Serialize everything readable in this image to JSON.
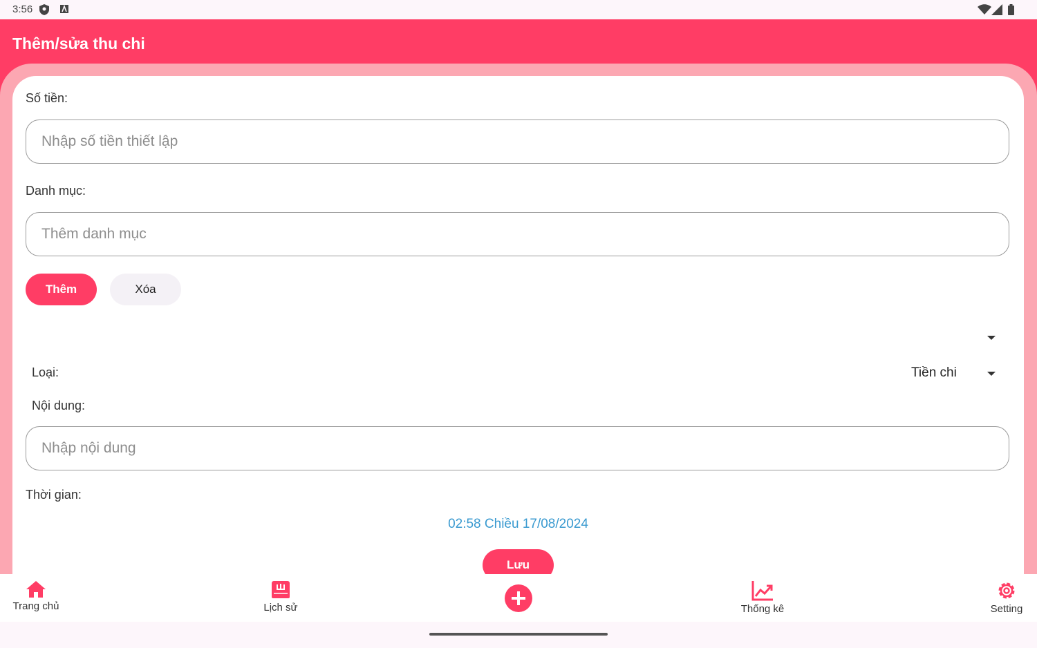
{
  "status_bar": {
    "time": "3:56"
  },
  "app_bar": {
    "title": "Thêm/sửa thu chi"
  },
  "form": {
    "amount_label": "Số tiền:",
    "amount_placeholder": "Nhập số tiền thiết lập",
    "category_label": "Danh mục:",
    "category_placeholder": "Thêm danh mục",
    "add_button": "Thêm",
    "delete_button": "Xóa",
    "category_dropdown_value": "",
    "type_label": "Loại:",
    "type_value": "Tiền chi",
    "content_label": "Nội dung:",
    "content_placeholder": "Nhập nội dung",
    "time_label": "Thời gian:",
    "datetime_value": "02:58 Chiều 17/08/2024",
    "save_button": "Lưu"
  },
  "bottom_nav": {
    "items": [
      {
        "label": "Trang chủ",
        "icon": "home-icon"
      },
      {
        "label": "Lịch sử",
        "icon": "history-book-icon"
      },
      {
        "label": "",
        "icon": "add-circle-icon"
      },
      {
        "label": "Thống kê",
        "icon": "chart-line-icon"
      },
      {
        "label": "Setting",
        "icon": "gear-icon"
      }
    ]
  },
  "colors": {
    "accent": "#ff3d65",
    "frame": "#fca7b2",
    "link": "#3a9ad0"
  }
}
